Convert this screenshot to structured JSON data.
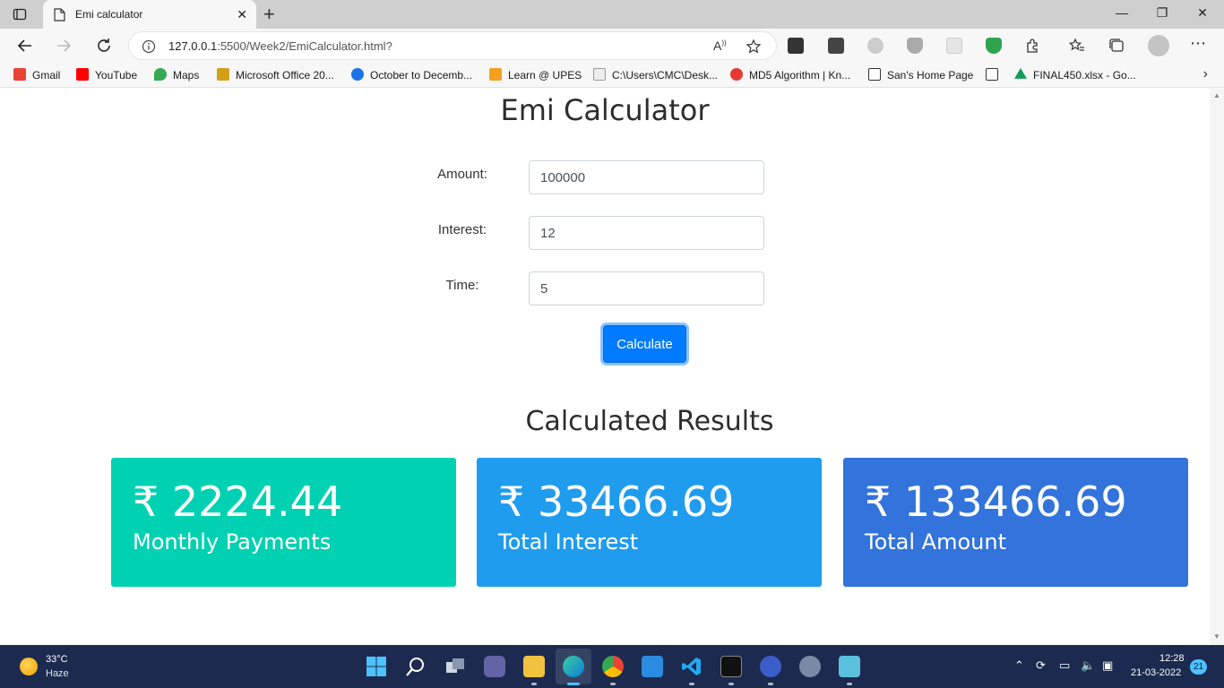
{
  "browser": {
    "tab_title": "Emi calculator",
    "url_host": "127.0.0.1",
    "url_rest": ":5500/Week2/EmiCalculator.html?",
    "bookmarks": [
      {
        "label": "Gmail",
        "color": "#ea4335"
      },
      {
        "label": "YouTube",
        "color": "#ff0000"
      },
      {
        "label": "Maps",
        "color": "#34a853"
      },
      {
        "label": "Microsoft Office 20...",
        "color": "#d4a017"
      },
      {
        "label": "October to Decemb...",
        "color": "#1a73e8"
      },
      {
        "label": "Learn @ UPES",
        "color": "#f4a020"
      },
      {
        "label": "C:\\Users\\CMC\\Desk...",
        "color": "#9e9e9e"
      },
      {
        "label": "MD5 Algorithm | Kn...",
        "color": "#e53935"
      },
      {
        "label": "San's Home Page",
        "color": "#ffffff"
      },
      {
        "label": "",
        "color": "#ffffff"
      },
      {
        "label": "FINAL450.xlsx - Go...",
        "color": "#0f9d58"
      }
    ]
  },
  "page": {
    "title": "Emi Calculator",
    "form": {
      "amount_label": "Amount:",
      "amount_value": "100000",
      "interest_label": "Interest:",
      "interest_value": "12",
      "time_label": "Time:",
      "time_value": "5",
      "button_label": "Calculate"
    },
    "results_title": "Calculated Results",
    "cards": [
      {
        "value": "₹ 2224.44",
        "label": "Monthly Payments",
        "color": "#00d1b2"
      },
      {
        "value": "₹ 33466.69",
        "label": "Total Interest",
        "color": "#209cee"
      },
      {
        "value": "₹ 133466.69",
        "label": "Total Amount",
        "color": "#3273dc"
      }
    ]
  },
  "taskbar": {
    "temperature": "33°C",
    "condition": "Haze",
    "time": "12:28",
    "date": "21-03-2022",
    "notification_count": "21"
  }
}
